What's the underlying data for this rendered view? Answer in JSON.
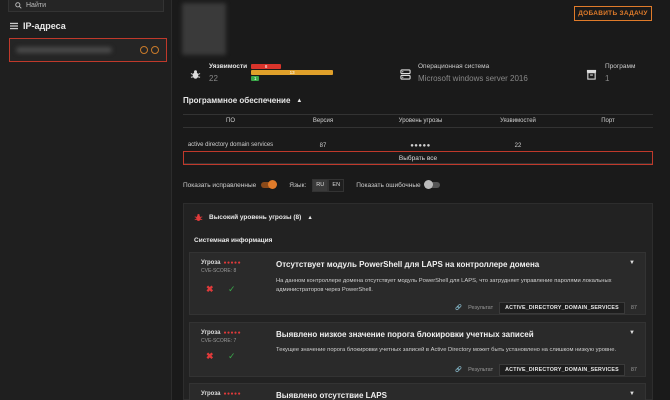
{
  "sidebar": {
    "search_placeholder": "Найти",
    "title": "IP-адреса"
  },
  "header": {
    "add_task_label": "ДОБАВИТЬ ЗАДАЧУ"
  },
  "stats": {
    "vulns": {
      "label": "Уязвимости",
      "value": "22",
      "bars": [
        {
          "value": "8",
          "color": "#d9342b",
          "fill": 0.36
        },
        {
          "value": "13",
          "color": "#e0a02a",
          "fill": 0.98
        },
        {
          "value": "1",
          "color": "#3aa84a",
          "fill": 0.1
        }
      ]
    },
    "os": {
      "label": "Операционная система",
      "value": "Microsoft windows server 2016"
    },
    "programs": {
      "label": "Программ",
      "value": "1"
    }
  },
  "software": {
    "title": "Программное обеспечение",
    "columns": [
      "ПО",
      "Версия",
      "Уровень угрозы",
      "Уязвимостей",
      "Порт"
    ],
    "rows": [
      {
        "name": "active directory domain services",
        "version": "87",
        "threat": "●●●●●",
        "vulns": "22",
        "port": ""
      }
    ],
    "select_all_label": "Выбрать все"
  },
  "filters": {
    "show_fixed_label": "Показать исправленные",
    "language_label": "Язык:",
    "lang_ru": "RU",
    "lang_en": "EN",
    "show_false_label": "Показать ошибочные"
  },
  "threats": {
    "header": "Высокий уровень угрозы (8)",
    "section": "Системная информация",
    "cards": [
      {
        "level_label": "Угроза",
        "cve": "CVE-SCORE: 8",
        "title": "Отсутствует модуль PowerShell для LAPS на контроллере домена",
        "desc": "На данном контроллере домена отсутствует модуль PowerShell для LAPS, что затрудняет управление паролями локальных администраторов через PowerShell.",
        "result_label": "Результат",
        "tag": "ACTIVE_DIRECTORY_DOMAIN_SERVICES",
        "count": "87"
      },
      {
        "level_label": "Угроза",
        "cve": "CVE-SCORE: 7",
        "title": "Выявлено низкое значение порога блокировки учетных записей",
        "desc": "Текущее значение порога блокировки учетных записей в Active Directory может быть установлено на слишком низкую уровне.",
        "result_label": "Результат",
        "tag": "ACTIVE_DIRECTORY_DOMAIN_SERVICES",
        "count": "87"
      },
      {
        "level_label": "Угроза",
        "cve": "",
        "title": "Выявлено отсутствие LAPS",
        "desc": "",
        "result_label": "",
        "tag": "",
        "count": ""
      }
    ]
  },
  "threat_dots": "●●●●●"
}
